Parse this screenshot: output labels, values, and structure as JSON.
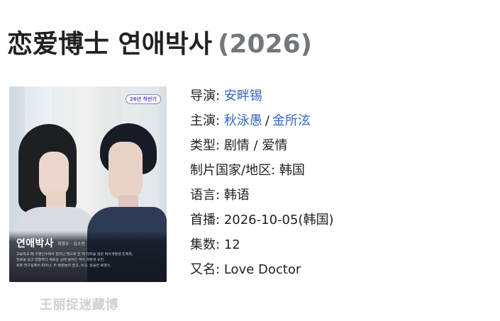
{
  "header": {
    "title": "恋爱博士 연애박사",
    "year": "(2026)"
  },
  "poster": {
    "badge": "26년 하반기",
    "title": "연애박사",
    "names": "최영우 · 김소현",
    "description": [
      "고등학교 때 수영선수에서 밀려난 범으로 한 척 다리를 잃은 박사과정생 민재와,",
      "전로를 잃고 방황하다 새로운 길에 들어선 석사 과정생 유진.",
      "로봇 연구실에서 피어난, 두 청춘들의 열고, 쓰고, 달콤한 로맨스."
    ]
  },
  "details": {
    "director_label": "导演:",
    "director": "安畔锡",
    "cast_label": "主演:",
    "cast_1": "秋泳愚",
    "cast_separator": "/",
    "cast_2": "金所泫",
    "genre_label": "类型:",
    "genre": "剧情 / 爱情",
    "region_label": "制片国家/地区:",
    "region": "韩国",
    "language_label": "语言:",
    "language": "韩语",
    "premiere_label": "首播:",
    "premiere": "2026-10-05(韩国)",
    "episodes_label": "集数:",
    "episodes": "12",
    "aka_label": "又名:",
    "aka": "Love Doctor"
  },
  "watermark": {
    "text": "王丽捉迷藏博"
  }
}
